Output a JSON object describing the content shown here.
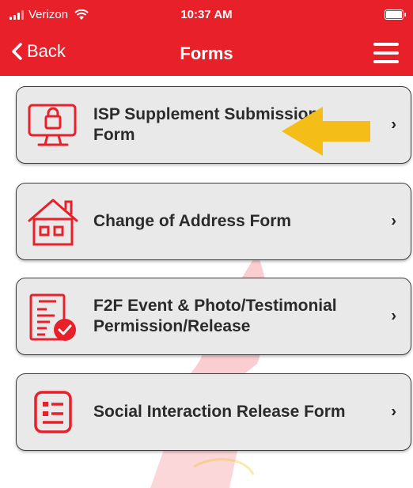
{
  "status_bar": {
    "carrier": "Verizon",
    "time": "10:37 AM"
  },
  "nav": {
    "back_label": "Back",
    "title": "Forms"
  },
  "forms": [
    {
      "label": "ISP Supplement Submission Form",
      "icon": "monitor-lock-icon"
    },
    {
      "label": "Change of Address Form",
      "icon": "house-icon"
    },
    {
      "label": "F2F Event & Photo/Testimonial Permission/Release",
      "icon": "clipboard-check-icon"
    },
    {
      "label": "Social Interaction Release Form",
      "icon": "id-card-icon"
    }
  ],
  "colors": {
    "brand_red": "#e8202a",
    "card_bg": "#e9e9ea",
    "arrow_yellow": "#f5bd18"
  }
}
